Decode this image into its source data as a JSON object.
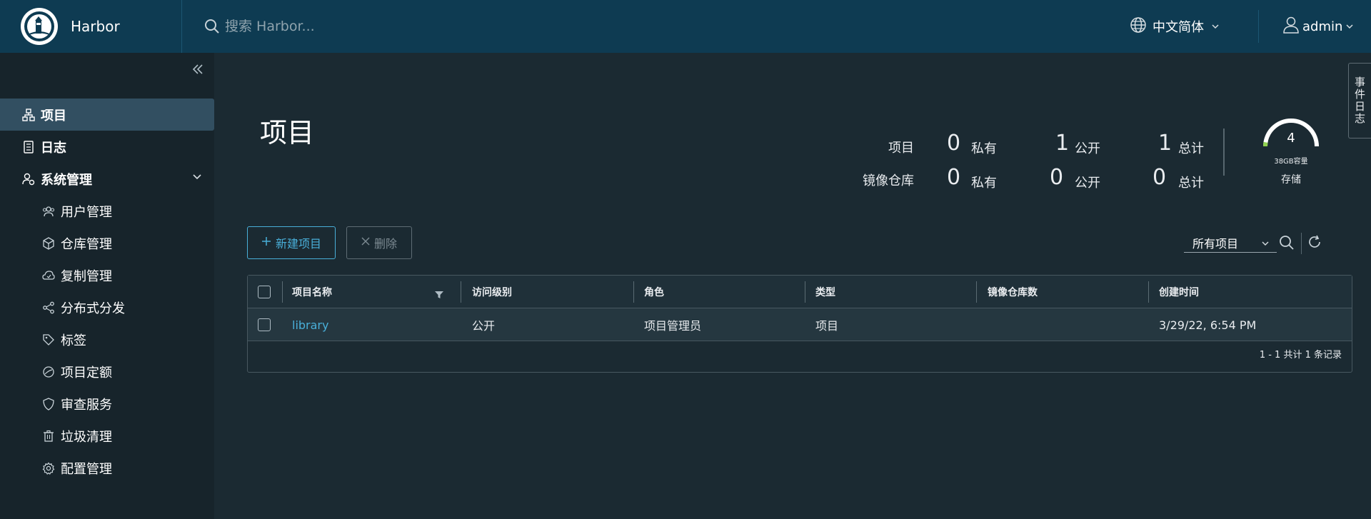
{
  "header": {
    "brand": "Harbor",
    "search_placeholder": "搜索 Harbor...",
    "language": "中文简体",
    "user": "admin"
  },
  "sidebar": {
    "items": [
      {
        "label": "项目",
        "icon": "projects-icon",
        "active": true
      },
      {
        "label": "日志",
        "icon": "logs-icon"
      },
      {
        "label": "系统管理",
        "icon": "admin-icon",
        "expanded": true
      },
      {
        "label": "用户管理",
        "icon": "users-icon"
      },
      {
        "label": "仓库管理",
        "icon": "registry-icon"
      },
      {
        "label": "复制管理",
        "icon": "replication-icon"
      },
      {
        "label": "分布式分发",
        "icon": "distribution-icon"
      },
      {
        "label": "标签",
        "icon": "tag-icon"
      },
      {
        "label": "项目定额",
        "icon": "quota-icon"
      },
      {
        "label": "审查服务",
        "icon": "shield-icon"
      },
      {
        "label": "垃圾清理",
        "icon": "trash-icon"
      },
      {
        "label": "配置管理",
        "icon": "gear-icon"
      }
    ]
  },
  "main": {
    "title": "项目",
    "stats": {
      "rows": [
        {
          "label": "项目",
          "private": "0",
          "public": "1",
          "total": "1"
        },
        {
          "label": "镜像仓库",
          "private": "0",
          "public": "0",
          "total": "0"
        }
      ],
      "private_label": "私有",
      "public_label": "公开",
      "total_label": "总计"
    },
    "storage": {
      "value": "4",
      "capacity": "38GB容量",
      "label": "存储",
      "used_fraction": 0.05
    },
    "toolbar": {
      "new_project": "新建项目",
      "delete": "删除",
      "filter_value": "所有项目"
    },
    "table": {
      "headers": [
        "项目名称",
        "访问级别",
        "角色",
        "类型",
        "镜像仓库数",
        "创建时间"
      ],
      "rows": [
        {
          "name": "library",
          "access": "公开",
          "role": "项目管理员",
          "type": "项目",
          "repo_count": "",
          "created": "3/29/22, 6:54 PM"
        }
      ],
      "footer": "1 - 1 共计 1 条记录"
    },
    "side_tab": "事件日志"
  },
  "colors": {
    "header_bg": "#0e3b52",
    "sidebar_bg": "#17242b",
    "main_bg": "#1b2a32",
    "accent": "#49afd9"
  }
}
